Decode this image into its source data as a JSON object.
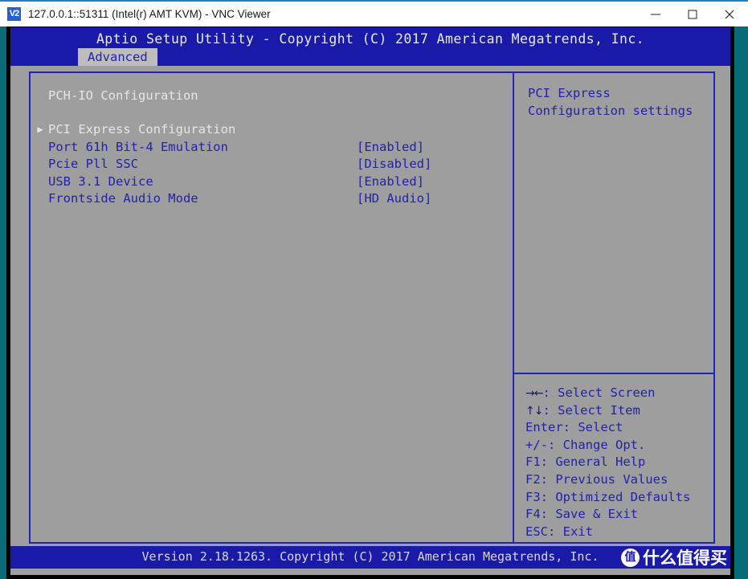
{
  "window": {
    "logo_label": "V2",
    "title": "127.0.0.1::51311 (Intel(r) AMT KVM) - VNC Viewer",
    "controls": {
      "minimize": "minimize-icon",
      "maximize": "maximize-icon",
      "close": "close-icon"
    }
  },
  "bios": {
    "title": "Aptio Setup Utility - Copyright (C) 2017 American Megatrends, Inc.",
    "active_tab": "Advanced",
    "tabs": [
      "Advanced"
    ],
    "section_title": "PCH-IO Configuration",
    "rows": [
      {
        "marker": "▶",
        "label": "PCI Express Configuration",
        "value": "",
        "selected": true
      },
      {
        "marker": "",
        "label": "Port 61h Bit-4 Emulation",
        "value": "[Enabled]",
        "selected": false
      },
      {
        "marker": "",
        "label": "Pcie Pll SSC",
        "value": "[Disabled]",
        "selected": false
      },
      {
        "marker": "",
        "label": "USB 3.1 Device",
        "value": "[Enabled]",
        "selected": false
      },
      {
        "marker": "",
        "label": "Frontside Audio Mode",
        "value": "[HD Audio]",
        "selected": false
      }
    ],
    "help_text": "PCI Express Configuration settings",
    "keys": [
      {
        "glyph": "→←",
        "text": ": Select Screen"
      },
      {
        "glyph": "↑↓",
        "text": ": Select Item"
      },
      {
        "glyph": "",
        "text": "Enter: Select"
      },
      {
        "glyph": "",
        "text": "+/-: Change Opt."
      },
      {
        "glyph": "",
        "text": "F1: General Help"
      },
      {
        "glyph": "",
        "text": "F2: Previous Values"
      },
      {
        "glyph": "",
        "text": "F3: Optimized Defaults"
      },
      {
        "glyph": "",
        "text": "F4: Save & Exit"
      },
      {
        "glyph": "",
        "text": "ESC: Exit"
      }
    ],
    "version": "Version 2.18.1263. Copyright (C) 2017 American Megatrends, Inc."
  },
  "watermark": {
    "badge": "值",
    "text": "什么值得买"
  },
  "colors": {
    "bios_blue": "#1a1aa8",
    "bios_gray": "#9e9e9e",
    "text_blue": "#2222aa",
    "text_light": "#e6e6e6",
    "desktop_teal": "#0b6a78"
  }
}
